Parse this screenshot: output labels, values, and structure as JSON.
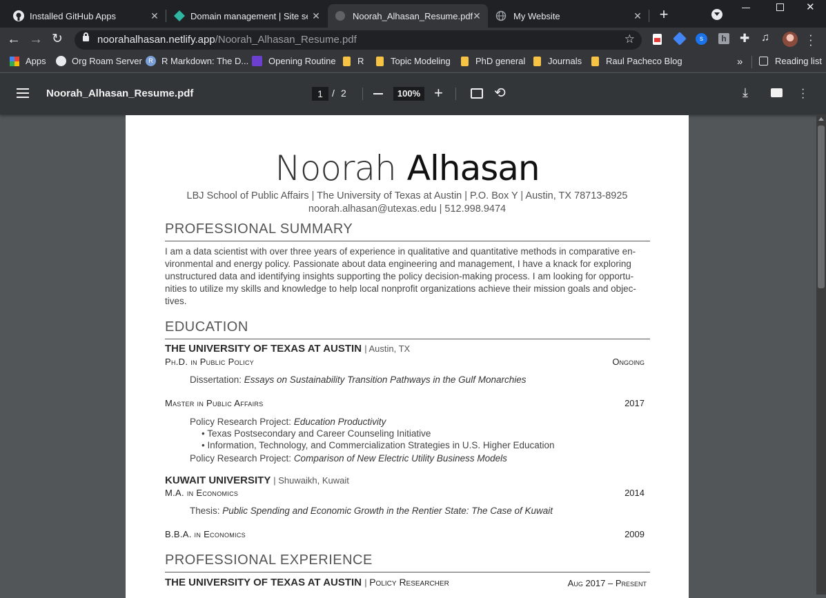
{
  "tabs": [
    {
      "title": "Installed GitHub Apps",
      "icon": "github-icon"
    },
    {
      "title": "Domain management | Site sett",
      "icon": "netlify-icon"
    },
    {
      "title": "Noorah_Alhasan_Resume.pdf",
      "icon": "globe-icon"
    },
    {
      "title": "My Website",
      "icon": "globe-icon"
    }
  ],
  "address": {
    "domain": "noorahalhasan.netlify.app",
    "path": "/Noorah_Alhasan_Resume.pdf"
  },
  "bookmarks": [
    {
      "label": "Apps"
    },
    {
      "label": "Org Roam Server"
    },
    {
      "label": "R Markdown: The D..."
    },
    {
      "label": "Opening Routine"
    },
    {
      "label": "R"
    },
    {
      "label": "Topic Modeling"
    },
    {
      "label": "PhD general"
    },
    {
      "label": "Journals"
    },
    {
      "label": "Raul Pacheco Blog"
    }
  ],
  "reading_list": "Reading list",
  "pdf": {
    "filename": "Noorah_Alhasan_Resume.pdf",
    "page_current": "1",
    "page_total": "2",
    "zoom": "100%"
  },
  "resume": {
    "first_name": "Noorah",
    "last_name": "Alhasan",
    "address": "LBJ School of Public Affairs | The University of Texas at Austin | P.O. Box Y | Austin, TX 78713-8925",
    "contact": "noorah.alhasan@utexas.edu | 512.998.9474",
    "summary_heading": "PROFESSIONAL SUMMARY",
    "summary_lines": [
      "I am a data scientist with over three years of experience in qualitative and quantitative methods in comparative en-",
      "vironmental and energy policy.  Passionate about data engineering and management, I have a knack for exploring",
      "unstructured data and identifying insights supporting the policy decision-making process. I am looking for opportu-",
      "nities to utilize my skills and knowledge to help local nonprofit organizations achieve their mission goals and objec-",
      "tives."
    ],
    "education_heading": "EDUCATION",
    "ut_name": "THE UNIVERSITY OF TEXAS AT AUSTIN",
    "ut_loc": "Austin, TX",
    "phd": "Ph.D. in Public Policy",
    "phd_year": "Ongoing",
    "dissertation_label": "Dissertation: ",
    "dissertation_title": "Essays on Sustainability Transition Pathways in the Gulf Monarchies",
    "mpa": "Master in Public Affairs",
    "mpa_year": "2017",
    "prp_label": "Policy Research Project: ",
    "prp1_title": "Education Productivity",
    "prp1_bullets": [
      "Texas Postsecondary and Career Counseling Initiative",
      "Information, Technology, and Commercialization Strategies in U.S. Higher Education"
    ],
    "prp2_title": "Comparison of New Electric Utility Business Models",
    "ku_name": "KUWAIT UNIVERSITY",
    "ku_loc": "Shuwaikh, Kuwait",
    "ma": "M.A. in Economics",
    "ma_year": "2014",
    "thesis_label": "Thesis: ",
    "thesis_title": "Public Spending and Economic Growth in the Rentier State: The Case of Kuwait",
    "bba": "B.B.A. in Economics",
    "bba_year": "2009",
    "experience_heading": "PROFESSIONAL EXPERIENCE",
    "job_org": "THE UNIVERSITY OF TEXAS AT AUSTIN",
    "job_title": "Policy Researcher",
    "job_dates": "Aug 2017 – Present"
  }
}
